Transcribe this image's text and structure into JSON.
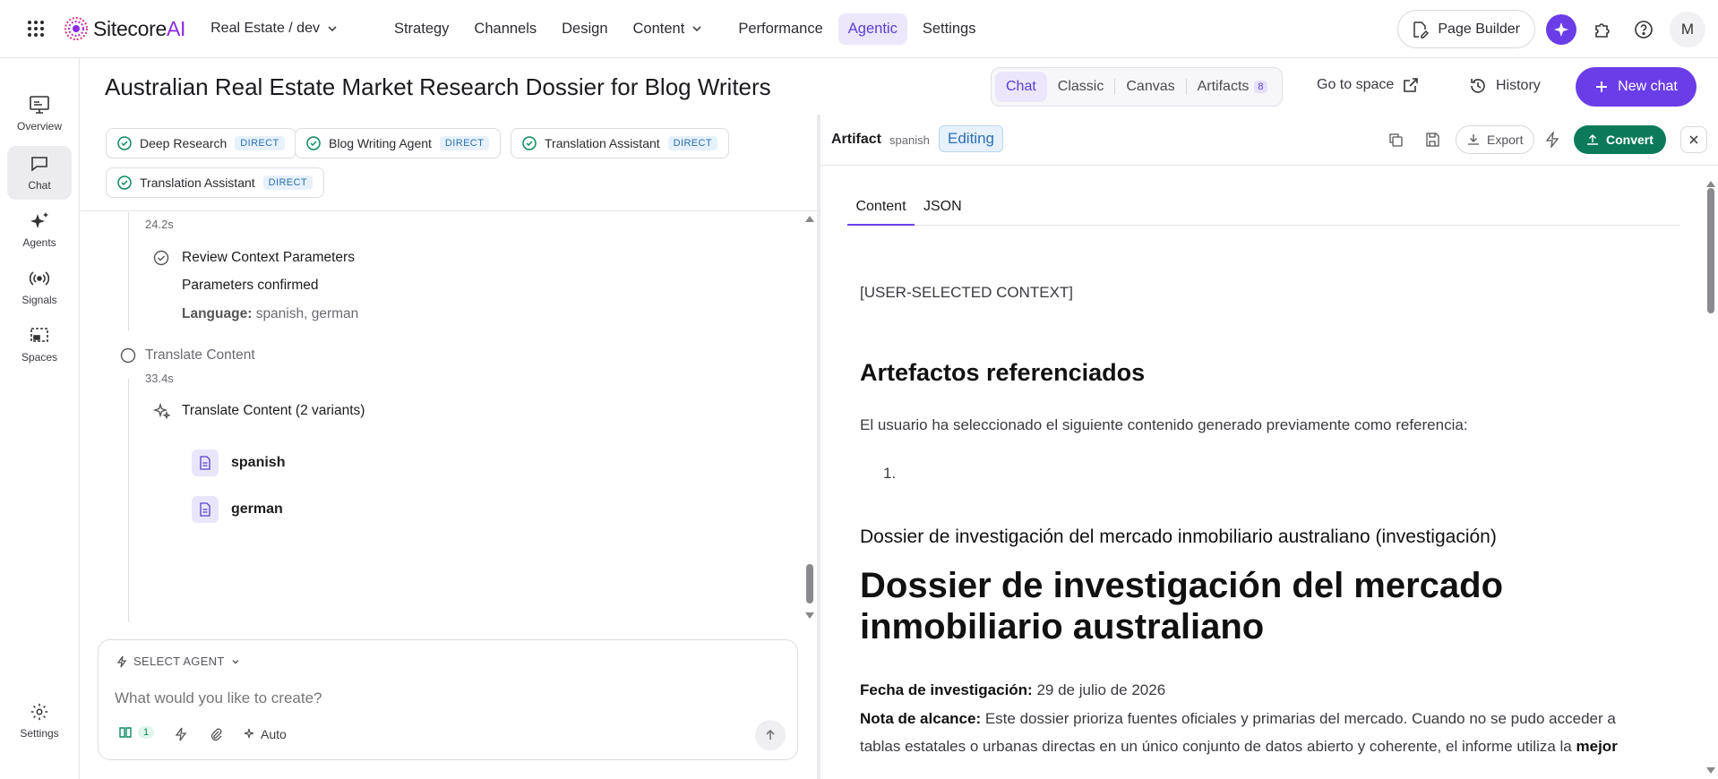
{
  "topbar": {
    "logo": "SitecoreAI",
    "environment": "Real Estate / dev",
    "nav": [
      "Strategy",
      "Channels",
      "Design",
      "Content",
      "Performance",
      "Agentic",
      "Settings"
    ],
    "page_builder": "Page Builder",
    "avatar": "M"
  },
  "rail": {
    "items": [
      "Overview",
      "Chat",
      "Agents",
      "Signals",
      "Spaces"
    ],
    "settings": "Settings"
  },
  "header": {
    "title": "Australian Real Estate Market Research Dossier for Blog Writers",
    "tabs": [
      "Chat",
      "Classic",
      "Canvas",
      "Artifacts"
    ],
    "artifacts_count": "8",
    "go_to_space": "Go to space",
    "history": "History",
    "new_chat": "New chat"
  },
  "agents": [
    {
      "name": "Deep Research",
      "tag": "DIRECT"
    },
    {
      "name": "Blog Writing Agent",
      "tag": "DIRECT"
    },
    {
      "name": "Translation Assistant",
      "tag": "DIRECT"
    },
    {
      "name": "Translation Assistant",
      "tag": "DIRECT"
    }
  ],
  "timeline": {
    "time1": "24.2s",
    "review_title": "Review Context Parameters",
    "review_status": "Parameters confirmed",
    "language_label": "Language:",
    "language_value": "spanish, german",
    "translate_step": "Translate Content",
    "time2": "33.4s",
    "translate_variants": "Translate Content (2 variants)",
    "files": [
      "spanish",
      "german"
    ]
  },
  "composer": {
    "select_agent": "SELECT AGENT",
    "placeholder": "What would you like to create?",
    "kb_count": "1",
    "mode": "Auto"
  },
  "artifact": {
    "label": "Artifact",
    "variant": "spanish",
    "editing": "Editing",
    "export": "Export",
    "convert": "Convert",
    "tabs": [
      "Content",
      "JSON"
    ],
    "context_tag": "[USER-SELECTED CONTEXT]",
    "h2": "Artefactos referenciados",
    "intro": "El usuario ha seleccionado el siguiente contenido generado previamente como referencia:",
    "list_marker": "1.",
    "subheading": "Dossier de investigación del mercado inmobiliario australiano (investigación)",
    "h1": "Dossier de investigación del mercado inmobiliario australiano",
    "date_label": "Fecha de investigación:",
    "date_value": "29 de julio de 2026",
    "scope_label": "Nota de alcance:",
    "scope_text_1": "Este dossier prioriza fuentes oficiales y primarias del mercado. Cuando no se pudo acceder a",
    "scope_text_2": "tablas estatales o urbanas directas en un único conjunto de datos abierto y coherente, el informe utiliza la",
    "scope_bold": "mejor"
  },
  "colors": {
    "accent": "#6b3de8",
    "convert": "#0b7a5a",
    "direct_tag": "#2a6fb3"
  }
}
